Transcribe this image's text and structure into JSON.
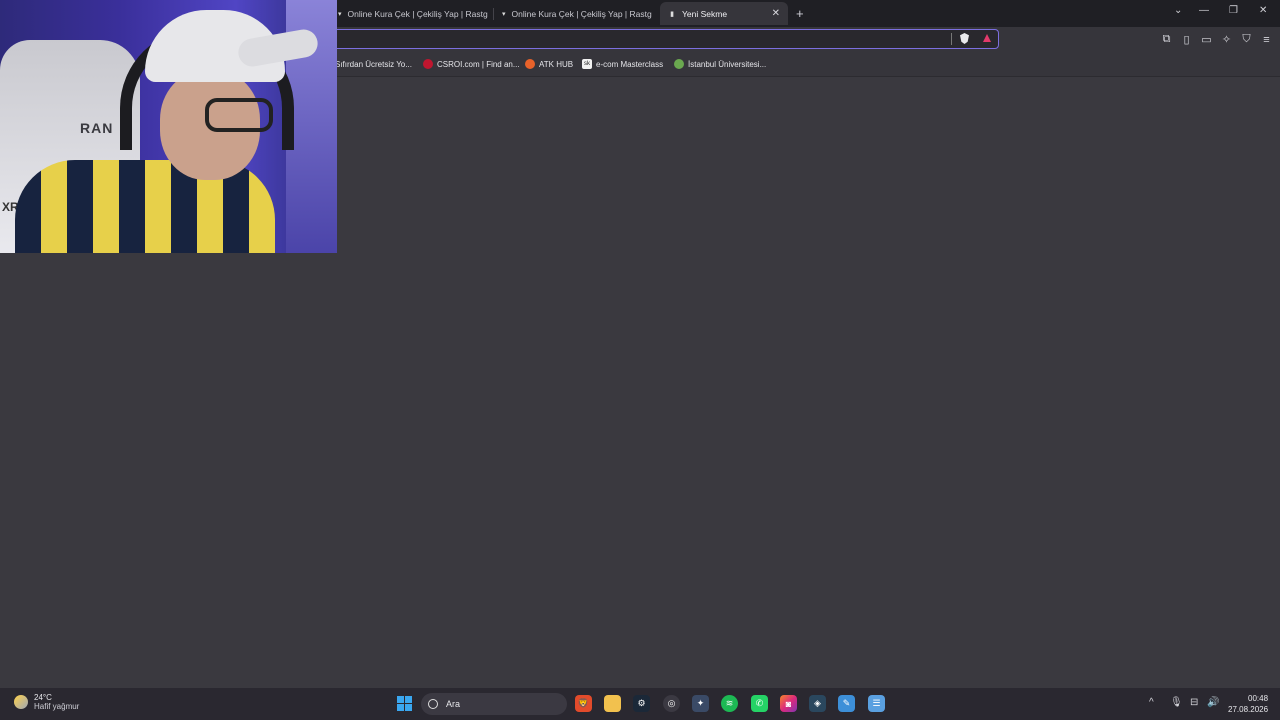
{
  "tabs": [
    {
      "title": "Online Kura Çek | Çekiliş Yap | Rastge",
      "active": false
    },
    {
      "title": "Online Kura Çek | Çekiliş Yap | Rastge",
      "active": false
    },
    {
      "title": "Yeni Sekme",
      "active": true
    }
  ],
  "tab_close_glyph": "✕",
  "new_tab_glyph": "+",
  "window_controls": {
    "dropdown": "⌄",
    "minimize": "—",
    "restore": "❐",
    "close": "✕"
  },
  "address_bar": {
    "value": "",
    "placeholder": ""
  },
  "toolbar_icons": [
    "extensions-icon",
    "sidebar-icon",
    "wallet-icon",
    "leo-ai-icon",
    "vpn-shield-icon",
    "menu-icon"
  ],
  "bookmarks": [
    {
      "label": "Sıfırdan Ücretsiz Yo...",
      "icon": "bookmark-favicon"
    },
    {
      "label": "CSROI.com | Find an...",
      "icon": "csroi-favicon"
    },
    {
      "label": "ATK HUB",
      "icon": "atk-favicon"
    },
    {
      "label": "e-com Masterclass",
      "icon": "ecom-favicon"
    },
    {
      "label": "İstanbul Üniversitesi...",
      "icon": "university-favicon"
    }
  ],
  "webcam": {
    "chair_logo": "RAN",
    "chair_logo2": "XR"
  },
  "taskbar": {
    "weather": {
      "temp": "24°C",
      "desc": "Hafif yağmur"
    },
    "search_placeholder": "Ara",
    "apps": [
      "brave-browser-icon",
      "file-explorer-icon",
      "steam-icon",
      "chrome-icon",
      "xbox-icon",
      "spotify-icon",
      "whatsapp-icon",
      "instagram-icon",
      "steam-alt-icon",
      "paint-icon",
      "notepad-icon"
    ],
    "tray": {
      "chevron": "^",
      "mic": "🎙",
      "network": "⊟",
      "volume": "🔊"
    },
    "clock": {
      "time": "00:48",
      "date": "27.08.2026"
    }
  },
  "colors": {
    "accent": "#7c6fe0",
    "brave": "#e24b2b",
    "page_bg": "#3a393f"
  }
}
